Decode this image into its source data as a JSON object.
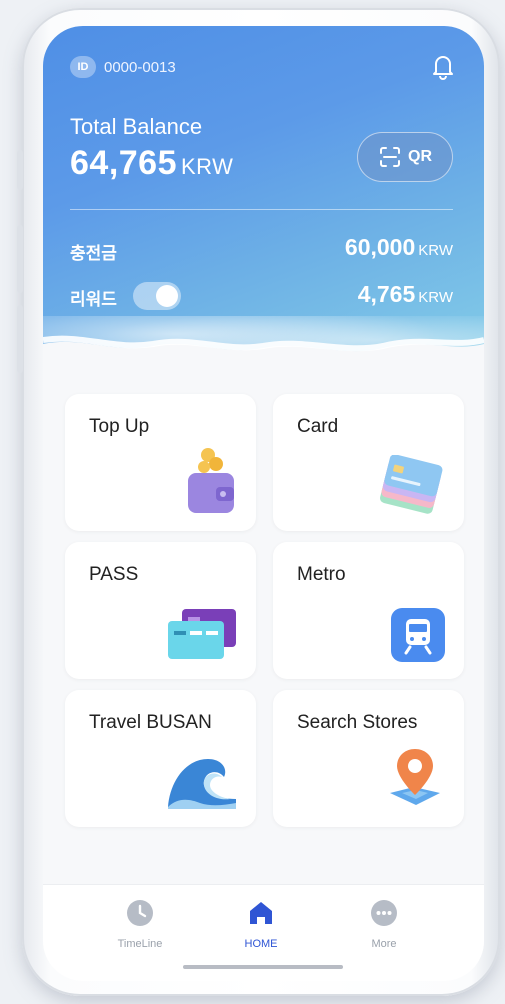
{
  "header": {
    "id_badge": "ID",
    "id_value": "0000-0013",
    "total_balance_label": "Total Balance",
    "total_balance_value": "64,765",
    "total_balance_unit": "KRW",
    "qr_label": "QR",
    "charge_label": "충전금",
    "charge_value": "60,000",
    "charge_unit": "KRW",
    "reward_label": "리워드",
    "reward_value": "4,765",
    "reward_unit": "KRW",
    "reward_toggle_on": true
  },
  "menu": {
    "tiles": [
      {
        "label": "Top Up",
        "icon": "wallet-icon"
      },
      {
        "label": "Card",
        "icon": "cards-icon"
      },
      {
        "label": "PASS",
        "icon": "pass-cards-icon"
      },
      {
        "label": "Metro",
        "icon": "train-icon"
      },
      {
        "label": "Travel BUSAN",
        "icon": "wave-icon"
      },
      {
        "label": "Search Stores",
        "icon": "map-pin-icon"
      }
    ]
  },
  "tabbar": {
    "tabs": [
      {
        "label": "TimeLine",
        "icon": "clock-icon",
        "active": false
      },
      {
        "label": "HOME",
        "icon": "home-icon",
        "active": true
      },
      {
        "label": "More",
        "icon": "more-icon",
        "active": false
      }
    ]
  },
  "colors": {
    "header_start": "#4f8fe6",
    "header_end": "#86d0e8",
    "active_tab": "#2f55d4"
  }
}
